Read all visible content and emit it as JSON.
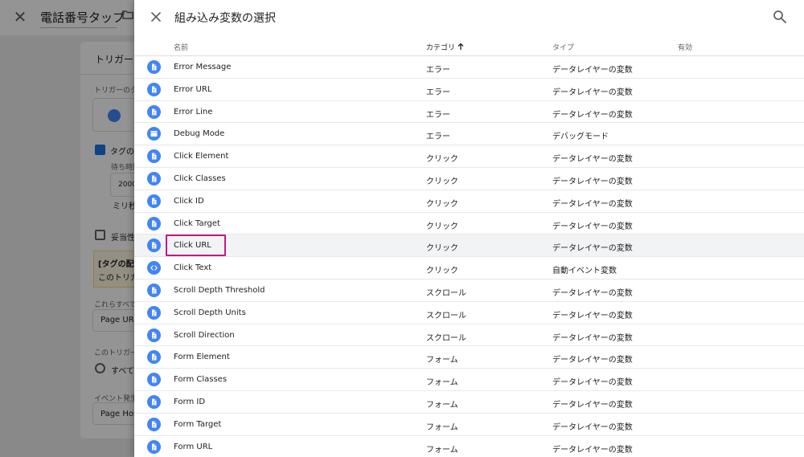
{
  "background": {
    "title": "電話番号タップ",
    "card_title": "トリガーの",
    "trigger_type_label": "トリガーのタ",
    "checkbox_label": "タグの",
    "wait_label": "待ち時間",
    "wait_value": "2000",
    "wait_unit": "ミリ秒",
    "validation_label": "妥当性",
    "warning_title": "[タグの配信",
    "warning_body": "このトリガ",
    "condition_label": "これらすべて",
    "condition_value": "Page URL",
    "trigger_fire_label": "このトリガー",
    "radio_label": "すべて",
    "event_label": "イベント発生",
    "event_value": "Page Hos"
  },
  "panel": {
    "title": "組み込み変数の選択",
    "columns": {
      "name": "名前",
      "category": "カテゴリ",
      "type": "タイプ",
      "enabled": "有効"
    },
    "rows": [
      {
        "name": "Error Message",
        "category": "エラー",
        "type": "データレイヤーの変数",
        "icon": "doc-icon"
      },
      {
        "name": "Error URL",
        "category": "エラー",
        "type": "データレイヤーの変数",
        "icon": "doc-icon"
      },
      {
        "name": "Error Line",
        "category": "エラー",
        "type": "データレイヤーの変数",
        "icon": "doc-icon"
      },
      {
        "name": "Debug Mode",
        "category": "エラー",
        "type": "デバッグモード",
        "icon": "window-icon"
      },
      {
        "name": "Click Element",
        "category": "クリック",
        "type": "データレイヤーの変数",
        "icon": "doc-icon"
      },
      {
        "name": "Click Classes",
        "category": "クリック",
        "type": "データレイヤーの変数",
        "icon": "doc-icon"
      },
      {
        "name": "Click ID",
        "category": "クリック",
        "type": "データレイヤーの変数",
        "icon": "doc-icon"
      },
      {
        "name": "Click Target",
        "category": "クリック",
        "type": "データレイヤーの変数",
        "icon": "doc-icon"
      },
      {
        "name": "Click URL",
        "category": "クリック",
        "type": "データレイヤーの変数",
        "icon": "doc-icon"
      },
      {
        "name": "Click Text",
        "category": "クリック",
        "type": "自動イベント変数",
        "icon": "code-icon"
      },
      {
        "name": "Scroll Depth Threshold",
        "category": "スクロール",
        "type": "データレイヤーの変数",
        "icon": "doc-icon"
      },
      {
        "name": "Scroll Depth Units",
        "category": "スクロール",
        "type": "データレイヤーの変数",
        "icon": "doc-icon"
      },
      {
        "name": "Scroll Direction",
        "category": "スクロール",
        "type": "データレイヤーの変数",
        "icon": "doc-icon"
      },
      {
        "name": "Form Element",
        "category": "フォーム",
        "type": "データレイヤーの変数",
        "icon": "doc-icon"
      },
      {
        "name": "Form Classes",
        "category": "フォーム",
        "type": "データレイヤーの変数",
        "icon": "doc-icon"
      },
      {
        "name": "Form ID",
        "category": "フォーム",
        "type": "データレイヤーの変数",
        "icon": "doc-icon"
      },
      {
        "name": "Form Target",
        "category": "フォーム",
        "type": "データレイヤーの変数",
        "icon": "doc-icon"
      },
      {
        "name": "Form URL",
        "category": "フォーム",
        "type": "データレイヤーの変数",
        "icon": "doc-icon"
      }
    ],
    "highlighted_row": "Click URL"
  },
  "colors": {
    "accent": "#4285f4",
    "highlight_border": "#c2188b",
    "checkbox": "#1a73e8"
  }
}
